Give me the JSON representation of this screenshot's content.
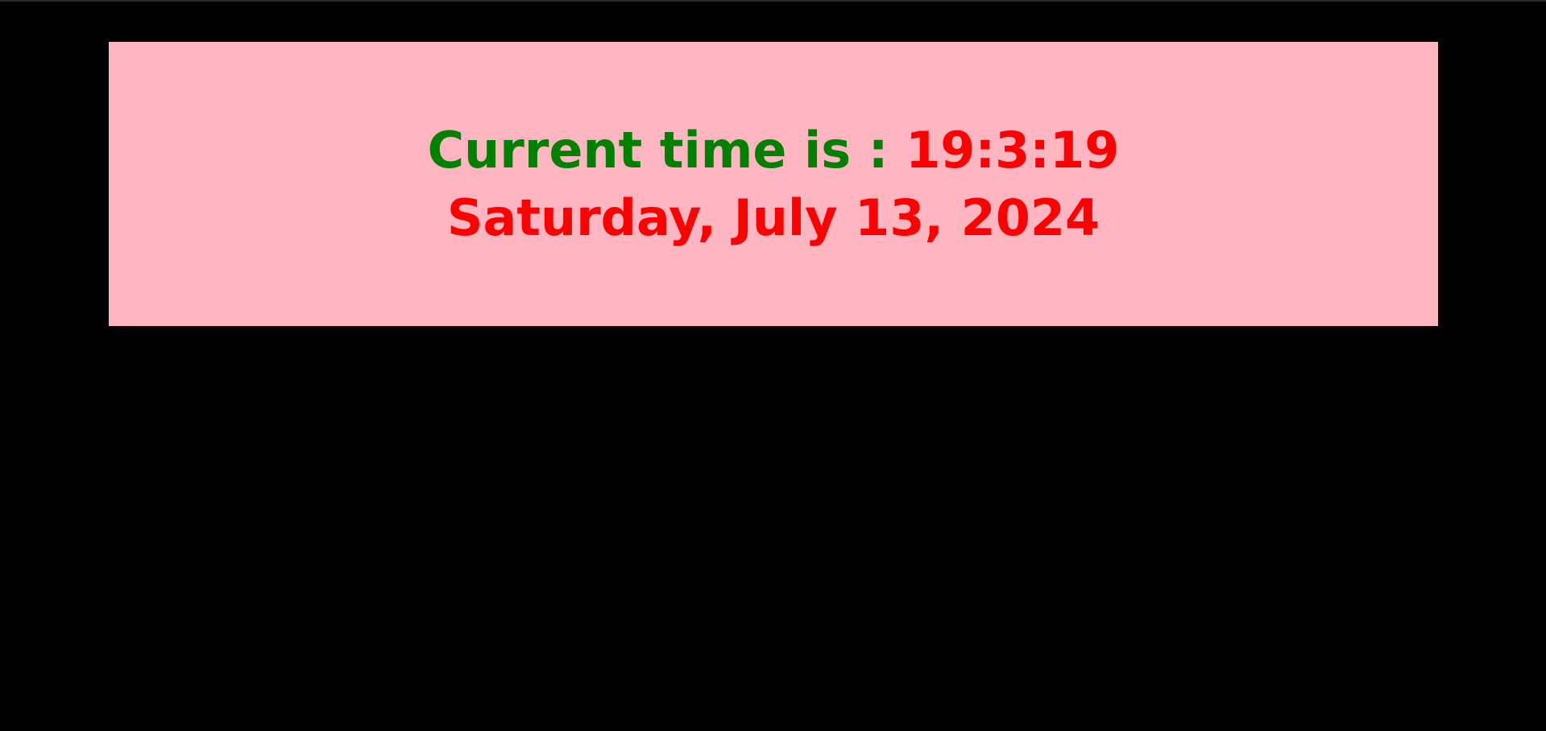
{
  "clock": {
    "label": "Current time is : ",
    "time": "19:3:19",
    "date": "Saturday, July 13, 2024"
  },
  "colors": {
    "page_background": "#000000",
    "panel_background": "#ffb6c1",
    "label_color": "#008000",
    "value_color": "#ff0000"
  }
}
